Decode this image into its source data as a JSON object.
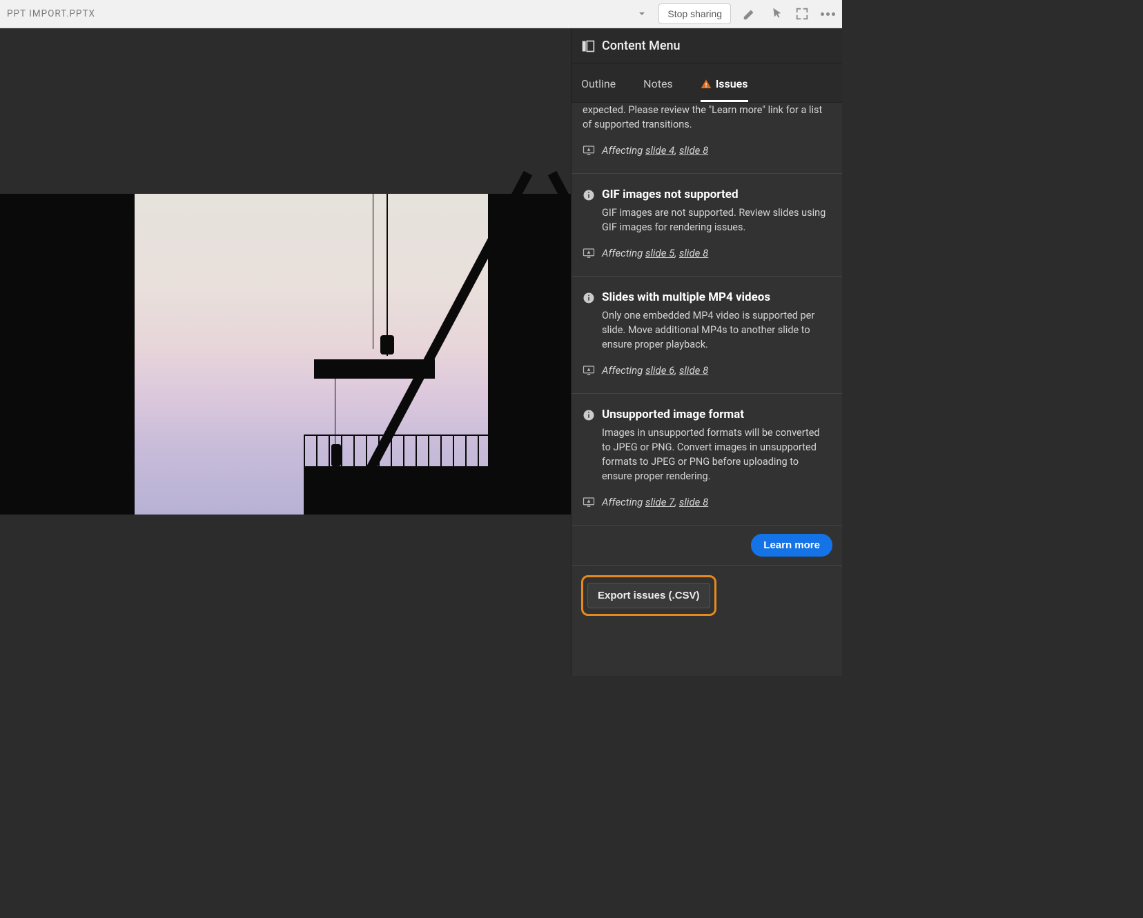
{
  "topbar": {
    "title": "PPT IMPORT.PPTX",
    "stop_sharing": "Stop sharing"
  },
  "panel": {
    "title": "Content Menu",
    "tabs": {
      "outline": "Outline",
      "notes": "Notes",
      "issues": "Issues"
    },
    "learn_more": "Learn more",
    "export_label": "Export issues (.CSV)"
  },
  "issues": [
    {
      "truncated_desc": "expected. Please review the \"Learn more\" link for a list of supported transitions.",
      "affecting_label": "Affecting",
      "affecting_links": [
        "slide 4",
        "slide 8"
      ]
    },
    {
      "title": "GIF images not supported",
      "desc": "GIF images are not supported. Review slides using GIF images for rendering issues.",
      "affecting_label": "Affecting",
      "affecting_links": [
        "slide 5",
        "slide 8"
      ]
    },
    {
      "title": "Slides with multiple MP4 videos",
      "desc": "Only one embedded MP4 video is supported per slide. Move additional MP4s to another slide to ensure proper playback.",
      "affecting_label": "Affecting",
      "affecting_links": [
        "slide 6",
        "slide 8"
      ]
    },
    {
      "title": "Unsupported image format",
      "desc": "Images in unsupported formats will be converted to JPEG or PNG. Convert images in unsupported formats to JPEG or PNG before uploading to ensure proper rendering.",
      "affecting_label": "Affecting",
      "affecting_links": [
        "slide 7",
        "slide 8"
      ]
    }
  ]
}
